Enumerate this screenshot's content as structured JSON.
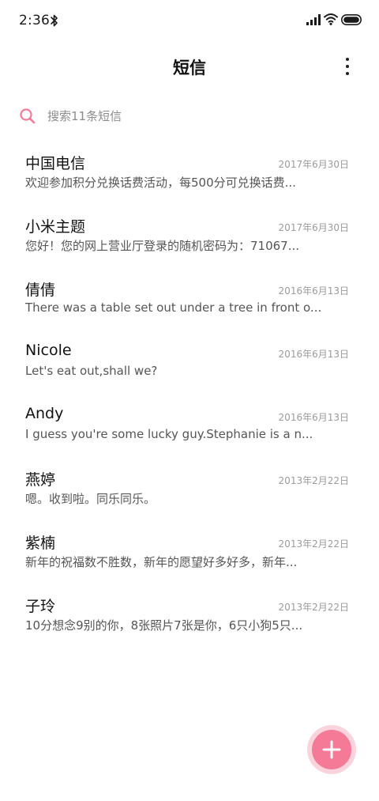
{
  "status_bar": {
    "time": "2:36",
    "icons": [
      "bluetooth-icon",
      "signal-icon",
      "wifi-icon",
      "battery-icon"
    ]
  },
  "header": {
    "title": "短信",
    "more_icon": "more-vertical-icon"
  },
  "search": {
    "placeholder": "搜索11条短信",
    "icon": "search-icon"
  },
  "colors": {
    "accent": "#f47a98",
    "accent_light": "#fbd3dc",
    "text_primary": "#111111",
    "text_secondary": "#555555",
    "text_muted": "#9b9b9b"
  },
  "messages": [
    {
      "sender": "中国电信",
      "date": "2017年6月30日",
      "preview": "欢迎参加积分兑换话费活动，每500分可兑换话费..."
    },
    {
      "sender": "小米主题",
      "date": "2017年6月30日",
      "preview": "您好！您的网上营业厅登录的随机密码为：71067..."
    },
    {
      "sender": "倩倩",
      "date": "2016年6月13日",
      "preview": "There was a table set out under a tree in front o..."
    },
    {
      "sender": "Nicole",
      "date": "2016年6月13日",
      "preview": "Let's eat out,shall we?"
    },
    {
      "sender": "Andy",
      "date": "2016年6月13日",
      "preview": "I guess you're some lucky guy.Stephanie is a n..."
    },
    {
      "sender": "燕婷",
      "date": "2013年2月22日",
      "preview": "嗯。收到啦。同乐同乐。"
    },
    {
      "sender": "紫楠",
      "date": "2013年2月22日",
      "preview": "新年的祝福数不胜数，新年的愿望好多好多，新年..."
    },
    {
      "sender": "子玲",
      "date": "2013年2月22日",
      "preview": "10分想念9别的你，8张照片7张是你，6只小狗5只..."
    }
  ],
  "fab": {
    "icon": "plus-icon"
  }
}
